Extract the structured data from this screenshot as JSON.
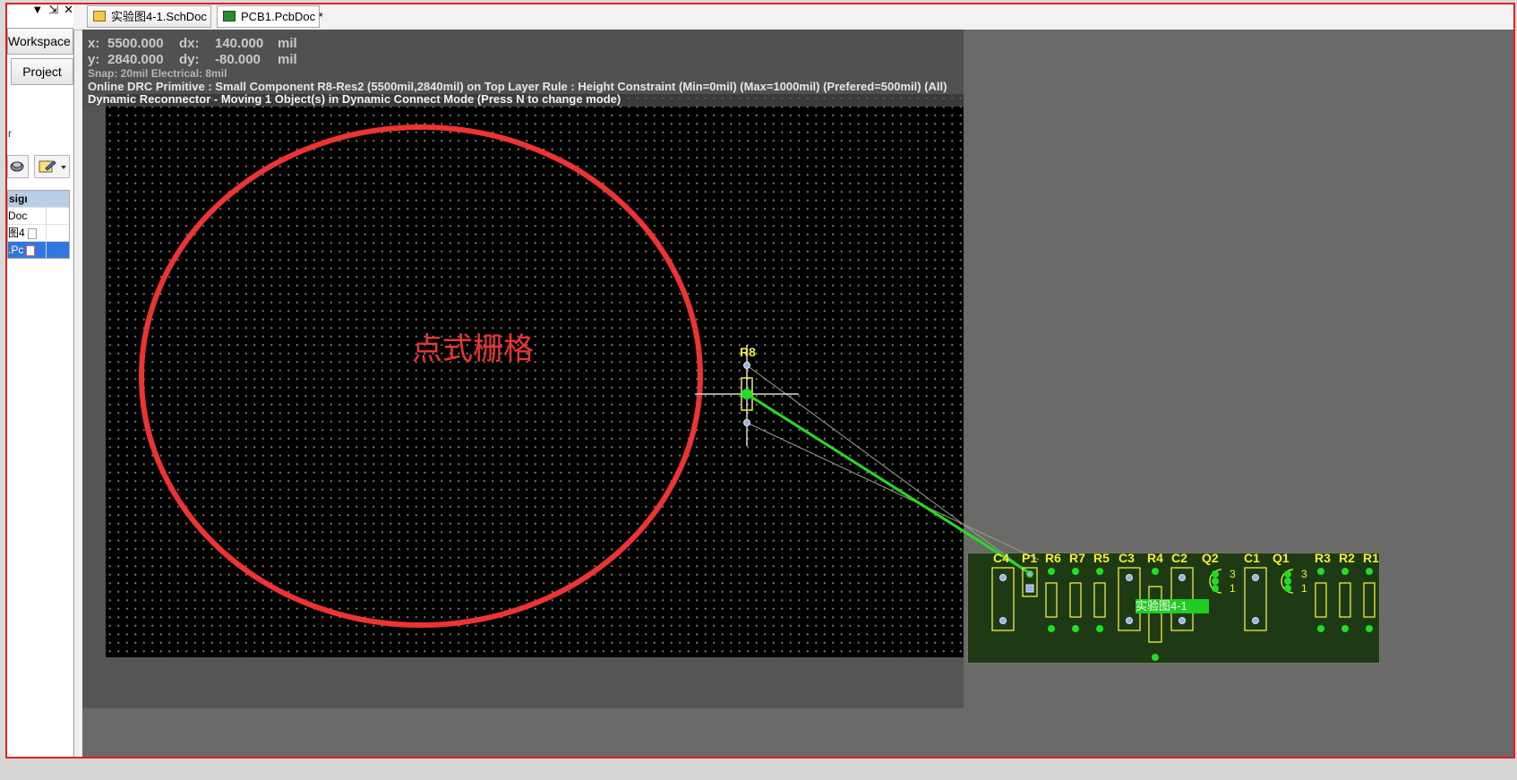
{
  "panel": {
    "controls": [
      "▼",
      "⇲",
      "✕"
    ],
    "workspace_label": "Workspace",
    "project_label": "Project",
    "fragment_label": "r",
    "tree_header": "sigı",
    "tree_rows": [
      {
        "label": "Doc",
        "selected": false
      },
      {
        "label": "图4",
        "selected": false
      },
      {
        "label": ".Pc",
        "selected": true
      }
    ]
  },
  "tabs": [
    {
      "label": "实验图4-1.SchDoc",
      "active": false
    },
    {
      "label": "PCB1.PcbDoc *",
      "active": true
    }
  ],
  "overlay": {
    "x_label": "x:",
    "x_value": "5500.000",
    "dx_label": "dx:",
    "dx_value": "140.000",
    "x_unit": "mil",
    "y_label": "y:",
    "y_value": "2840.000",
    "dy_label": "dy:",
    "dy_value": "-80.000",
    "y_unit": "mil",
    "snap": "Snap: 20mil Electrical: 8mil",
    "drc": "Online DRC Primitive : Small Component R8-Res2 (5500mil,2840mil) on Top Layer Rule : Height Constraint (Min=0mil) (Max=1000mil) (Prefered=500mil) (All)",
    "dynamic": "Dynamic Reconnector - Moving 1 Object(s) in Dynamic Connect Mode (Press N to change mode)"
  },
  "annotation": {
    "label": "点式栅格",
    "color": "#ee3333"
  },
  "moving_component": {
    "designator": "R8"
  },
  "board": {
    "component_class": "实验图4-1",
    "designators": [
      "C4",
      "P1",
      "R6",
      "R7",
      "R5",
      "C3",
      "R4",
      "C2",
      "Q2",
      "C1",
      "Q1",
      "R3",
      "R2",
      "R1"
    ],
    "pin_labels": [
      "3",
      "1",
      "3",
      "1"
    ]
  },
  "colors": {
    "silkscreen": "#f2ee3a",
    "connection": "#22dd22",
    "board_fill": "#1e3a15",
    "canvas": "#000000"
  }
}
